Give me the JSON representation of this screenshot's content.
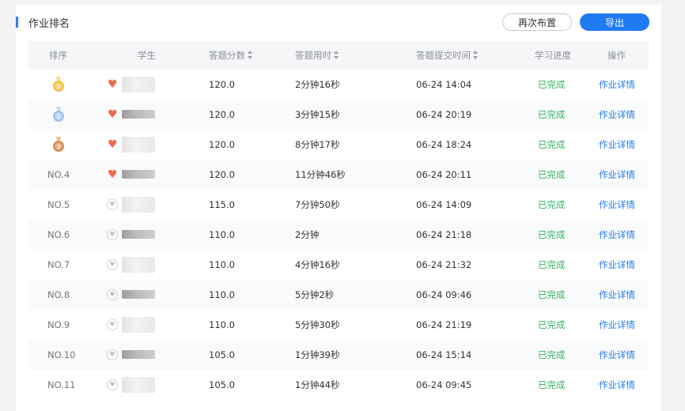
{
  "header": {
    "title": "作业排名",
    "reassign_label": "再次布置",
    "export_label": "导出"
  },
  "table": {
    "columns": [
      "排序",
      "学生",
      "答题分数",
      "答题用时",
      "答题提交时间",
      "学习进度",
      "操作"
    ],
    "rows": [
      {
        "rank": "",
        "medal": "gold",
        "liked": true,
        "score": "120.0",
        "duration": "2分钟16秒",
        "submit_time": "06-24 14:04",
        "progress": "已完成",
        "action": "作业详情"
      },
      {
        "rank": "",
        "medal": "silver",
        "liked": true,
        "score": "120.0",
        "duration": "3分钟15秒",
        "submit_time": "06-24 20:19",
        "progress": "已完成",
        "action": "作业详情"
      },
      {
        "rank": "",
        "medal": "bronze",
        "liked": true,
        "score": "120.0",
        "duration": "8分钟17秒",
        "submit_time": "06-24 18:24",
        "progress": "已完成",
        "action": "作业详情"
      },
      {
        "rank": "NO.4",
        "medal": "",
        "liked": true,
        "score": "120.0",
        "duration": "11分钟46秒",
        "submit_time": "06-24 20:11",
        "progress": "已完成",
        "action": "作业详情"
      },
      {
        "rank": "NO.5",
        "medal": "",
        "liked": false,
        "score": "115.0",
        "duration": "7分钟50秒",
        "submit_time": "06-24 14:09",
        "progress": "已完成",
        "action": "作业详情"
      },
      {
        "rank": "NO.6",
        "medal": "",
        "liked": false,
        "score": "110.0",
        "duration": "2分钟",
        "submit_time": "06-24 21:18",
        "progress": "已完成",
        "action": "作业详情"
      },
      {
        "rank": "NO.7",
        "medal": "",
        "liked": false,
        "score": "110.0",
        "duration": "4分钟16秒",
        "submit_time": "06-24 21:32",
        "progress": "已完成",
        "action": "作业详情"
      },
      {
        "rank": "NO.8",
        "medal": "",
        "liked": false,
        "score": "110.0",
        "duration": "5分钟2秒",
        "submit_time": "06-24 09:46",
        "progress": "已完成",
        "action": "作业详情"
      },
      {
        "rank": "NO.9",
        "medal": "",
        "liked": false,
        "score": "110.0",
        "duration": "5分钟30秒",
        "submit_time": "06-24 21:19",
        "progress": "已完成",
        "action": "作业详情"
      },
      {
        "rank": "NO.10",
        "medal": "",
        "liked": false,
        "score": "105.0",
        "duration": "1分钟39秒",
        "submit_time": "06-24 15:14",
        "progress": "已完成",
        "action": "作业详情"
      },
      {
        "rank": "NO.11",
        "medal": "",
        "liked": false,
        "score": "105.0",
        "duration": "1分钟44秒",
        "submit_time": "06-24 09:45",
        "progress": "已完成",
        "action": "作业详情"
      }
    ]
  },
  "colors": {
    "accent": "#1f7af4",
    "done": "#2fb55b",
    "heart": "#ef6a4c",
    "gold": "#f5c242",
    "silver": "#9cc3ea",
    "bronze": "#d98b52"
  }
}
